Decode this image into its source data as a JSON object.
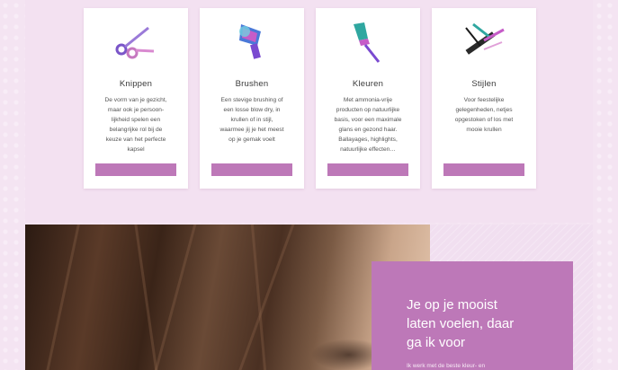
{
  "services": [
    {
      "icon": "scissors-icon",
      "title": "Knippen",
      "lines": [
        "De vorm van je gezicht,",
        "maar ook je persoon-",
        "lijkheid spelen een",
        "belangrijke rol bij de",
        "keuze van het perfecte",
        "kapsel"
      ]
    },
    {
      "icon": "hair-dryer-icon",
      "title": "Brushen",
      "lines": [
        "Een stevige brushing of",
        "een losse blow dry, in",
        "krullen of in stijl,",
        "waarmee jij je het meest",
        "op je gemak voelt"
      ]
    },
    {
      "icon": "dye-brush-icon",
      "title": "Kleuren",
      "lines": [
        "Met ammonia-vrije",
        "producten op natuurlijke",
        "basis, voor een maximale",
        "glans en gezond haar.",
        "Ballayages, highlights,",
        "natuurlijke effecten…"
      ]
    },
    {
      "icon": "comb-icon",
      "title": "Stijlen",
      "lines": [
        "Voor feestelijke",
        "gelegenheden, netjes",
        "opgestoken of los met",
        "mooie krullen"
      ]
    }
  ],
  "quote": {
    "heading_lines": [
      "Je op je mooist",
      "laten voelen, daar",
      "ga ik voor"
    ],
    "sub": "Ik werk met de beste kleur- en"
  },
  "colors": {
    "accent": "#bd78b8",
    "background": "#f4e4f2"
  }
}
